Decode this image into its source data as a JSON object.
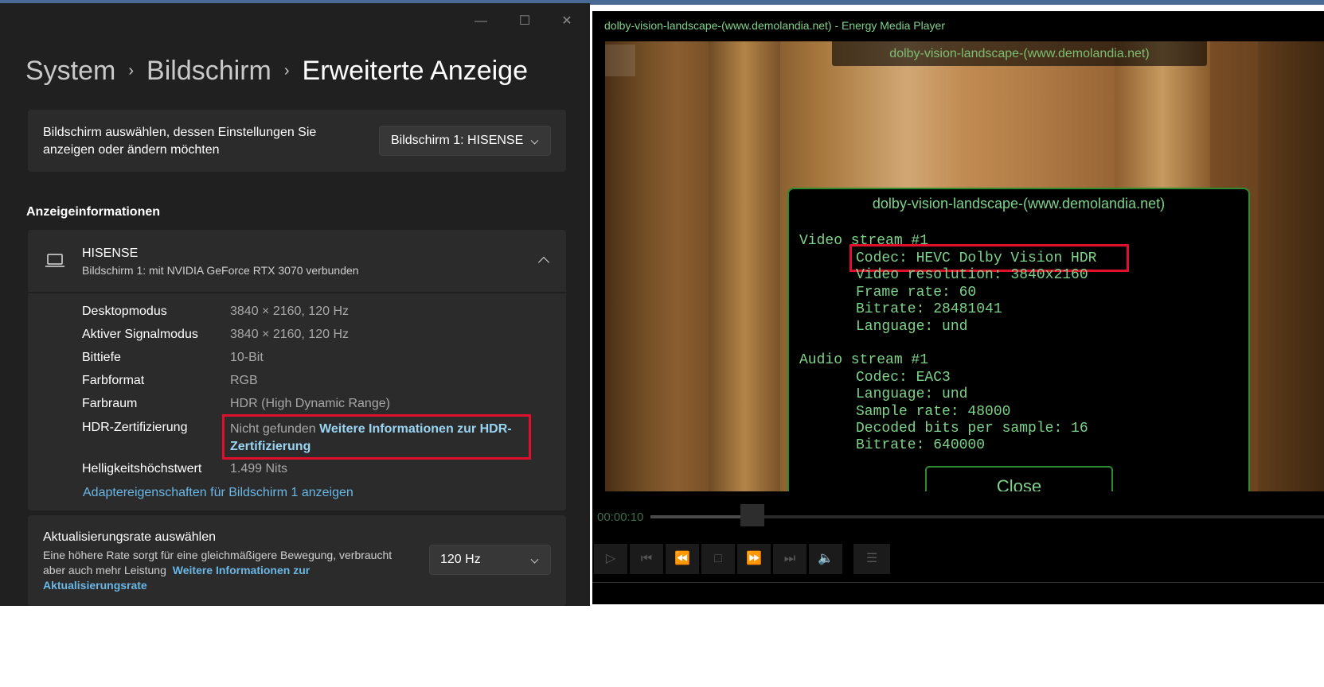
{
  "settings": {
    "window_controls": {
      "minimize": "—",
      "maximize": "☐",
      "close": "✕"
    },
    "breadcrumb": {
      "item1": "System",
      "item2": "Bildschirm",
      "current": "Erweiterte Anzeige",
      "separator": "›"
    },
    "display_select": {
      "label": "Bildschirm auswählen, dessen Einstellungen Sie anzeigen oder ändern möchten",
      "value": "Bildschirm 1: HISENSE"
    },
    "section_title": "Anzeigeinformationen",
    "monitor": {
      "name": "HISENSE",
      "subtitle": "Bildschirm 1: mit NVIDIA GeForce RTX 3070 verbunden"
    },
    "info_rows": [
      {
        "label": "Desktopmodus",
        "value": "3840 × 2160, 120 Hz"
      },
      {
        "label": "Aktiver Signalmodus",
        "value": "3840 × 2160, 120 Hz"
      },
      {
        "label": "Bittiefe",
        "value": "10-Bit"
      },
      {
        "label": "Farbformat",
        "value": "RGB"
      },
      {
        "label": "Farbraum",
        "value": "HDR (High Dynamic Range)"
      }
    ],
    "hdr_cert": {
      "label": "HDR-Zertifizierung",
      "value": "Nicht gefunden",
      "link_line1": "Weitere Informationen zur HDR-",
      "link_line2": "Zertifizierung"
    },
    "brightness": {
      "label": "Helligkeitshöchstwert",
      "value": "1.499 Nits"
    },
    "adapter_link": "Adaptereigenschaften für Bildschirm 1 anzeigen",
    "refresh": {
      "title": "Aktualisierungsrate auswählen",
      "desc_line1": "Eine höhere Rate sorgt für eine gleichmäßigere Bewegung, verbraucht",
      "desc_line2": "aber auch mehr Leistung",
      "link_line1": "Weitere Informationen zur",
      "link_line2": "Aktualisierungsrate",
      "value": "120 Hz"
    }
  },
  "player": {
    "window_title": "dolby-vision-landscape-(www.demolandia.net) - Energy Media Player",
    "overlay_title": "dolby-vision-landscape-(www.demolandia.net)",
    "dialog": {
      "title": "dolby-vision-landscape-(www.demolandia.net)",
      "video_header": "Video stream #1",
      "video_codec": "Codec: HEVC Dolby Vision HDR",
      "video_lines": [
        "Video resolution: 3840x2160",
        "Frame rate: 60",
        "Bitrate: 28481041",
        "Language: und"
      ],
      "audio_header": "Audio stream #1",
      "audio_lines": [
        "Codec: EAC3",
        "Language: und",
        "Sample rate: 48000",
        "Decoded bits per sample: 16",
        "Bitrate: 640000"
      ],
      "close_label": "Close"
    },
    "time": "00:00:10",
    "seek_progress": 0.15,
    "controls": {
      "play": "▷",
      "prev": "⏮",
      "rewind": "⏪",
      "stop": "□",
      "forward": "⏩",
      "next": "⏭",
      "volume": "🔈",
      "playlist": "☰"
    }
  }
}
